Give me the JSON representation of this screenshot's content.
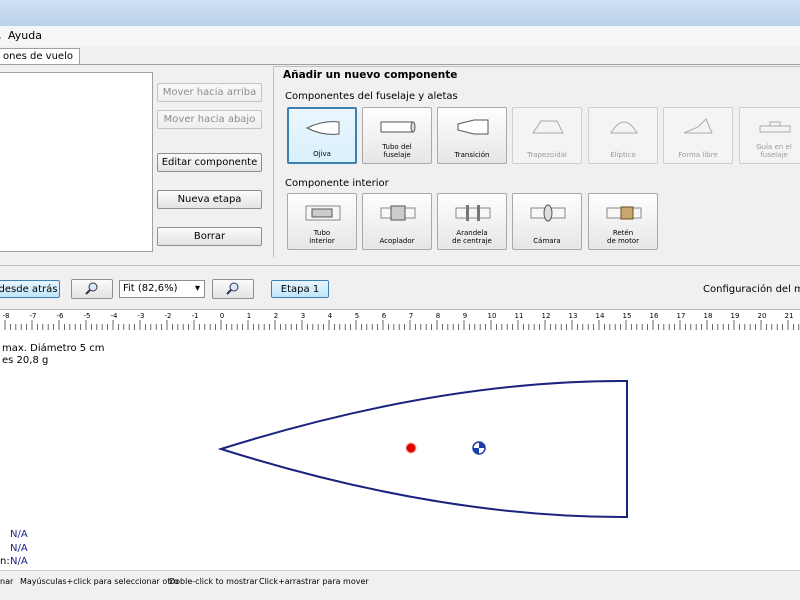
{
  "menu": {
    "help": "Ayuda"
  },
  "tabs": {
    "flight_simulations": "ones de vuelo"
  },
  "left_buttons": {
    "move_up": "Mover hacia arriba",
    "move_down": "Mover hacia abajo",
    "edit": "Editar componente",
    "new_stage": "Nueva etapa",
    "delete": "Borrar"
  },
  "add_panel": {
    "title": "Añadir un nuevo componente",
    "body_section": "Componentes del fuselaje y aletas",
    "inner_section": "Componente interior",
    "body_components": [
      {
        "label": "Ojiva",
        "icon": "nose-cone-icon"
      },
      {
        "label": "Tubo del\nfuselaje",
        "icon": "body-tube-icon"
      },
      {
        "label": "Transición",
        "icon": "transition-icon"
      },
      {
        "label": "Trapezoidal",
        "icon": "trapezoidal-fin-icon"
      },
      {
        "label": "Elíptico",
        "icon": "elliptical-fin-icon"
      },
      {
        "label": "Forma libre",
        "icon": "freeform-fin-icon"
      },
      {
        "label": "Guía en el\nfuselaje",
        "icon": "launch-lug-icon"
      }
    ],
    "inner_components": [
      {
        "label": "Tubo\ninterior",
        "icon": "inner-tube-icon"
      },
      {
        "label": "Acoplador",
        "icon": "coupler-icon"
      },
      {
        "label": "Arandela\nde centraje",
        "icon": "centering-ring-icon"
      },
      {
        "label": "Cámara",
        "icon": "bulkhead-icon"
      },
      {
        "label": "Retén\nde motor",
        "icon": "engine-block-icon"
      }
    ]
  },
  "toolbar": {
    "view_from_back": "desde atrás",
    "zoom": "Fit (82,6%)",
    "stage": "Etapa 1",
    "motor_config": "Configuración del motor"
  },
  "ruler_labels": [
    "-8",
    "-7",
    "-6",
    "-5",
    "-4",
    "-3",
    "-2",
    "-1",
    "0",
    "1",
    "2",
    "3",
    "4",
    "5",
    "6",
    "7",
    "8",
    "9",
    "10",
    "11",
    "12",
    "13",
    "14",
    "15",
    "16",
    "17",
    "18",
    "19",
    "20",
    "21"
  ],
  "info": {
    "line1": "max. Diámetro 5 cm",
    "line2": "es 20,8 g",
    "na1": "N/A",
    "na2": "N/A",
    "na3_prefix": "n:",
    "na3": "N/A"
  },
  "status": {
    "hint1": "nar",
    "hint2": "Mayúsculas+click para seleccionar otro",
    "hint3": "Doble-click to mostrar",
    "hint4": "Click+arrastrar para mover"
  },
  "colors": {
    "rocket_outline": "#1a237e",
    "cp_marker": "#e00000",
    "cg_marker": "#1a3faa"
  }
}
